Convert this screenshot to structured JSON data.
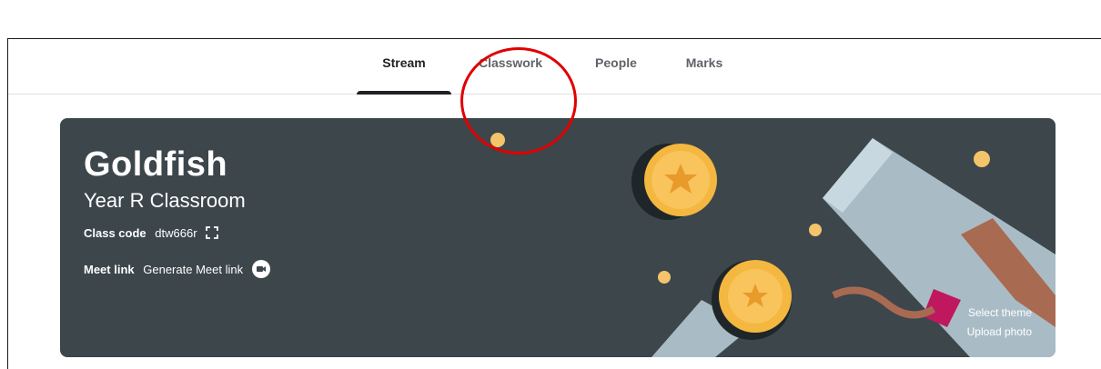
{
  "tabs": [
    {
      "label": "Stream",
      "active": true
    },
    {
      "label": "Classwork",
      "active": false
    },
    {
      "label": "People",
      "active": false
    },
    {
      "label": "Marks",
      "active": false
    }
  ],
  "banner": {
    "class_name": "Goldfish",
    "section": "Year R Classroom",
    "class_code_label": "Class code",
    "class_code": "dtw666r",
    "meet_label": "Meet link",
    "meet_value": "Generate Meet link",
    "select_theme": "Select theme",
    "upload_photo": "Upload photo"
  },
  "icons": {
    "expand": "fullscreen-icon",
    "meet": "meet-chat-icon"
  },
  "colors": {
    "banner_bg": "#3c464b",
    "active_tab": "#202124",
    "inactive_tab": "#5f6368",
    "annotation": "#e00000",
    "coin": "#f4b740"
  }
}
